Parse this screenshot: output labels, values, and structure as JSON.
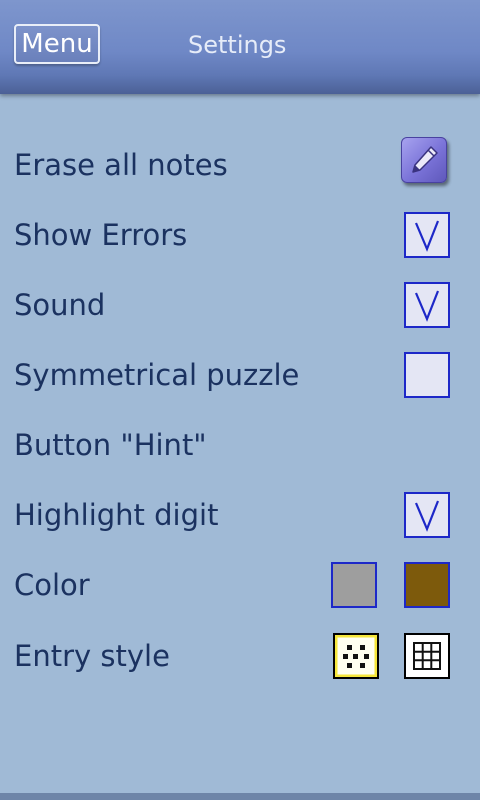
{
  "header": {
    "menu_label": "Menu",
    "title": "Settings"
  },
  "settings": {
    "erase_notes": {
      "label": "Erase all notes",
      "icon": "pencil-icon"
    },
    "show_errors": {
      "label": "Show Errors",
      "checked": true
    },
    "sound": {
      "label": "Sound",
      "checked": true
    },
    "symmetrical_puzzle": {
      "label": "Symmetrical puzzle",
      "checked": false
    },
    "hint_button": {
      "label": "Button \"Hint\""
    },
    "highlight_digit": {
      "label": "Highlight digit",
      "checked": true
    },
    "color": {
      "label": "Color",
      "swatches": [
        "#9e9e9e",
        "#7d5a0c"
      ]
    },
    "entry_style": {
      "label": "Entry style",
      "options": [
        "keypad-style-icon",
        "grid-style-icon"
      ]
    }
  },
  "colors": {
    "background": "#a0bad6",
    "header": "#6f88c6",
    "text": "#1b3260",
    "checkbox_border": "#1d28c8",
    "checkbox_fill": "#e4e6f4"
  }
}
